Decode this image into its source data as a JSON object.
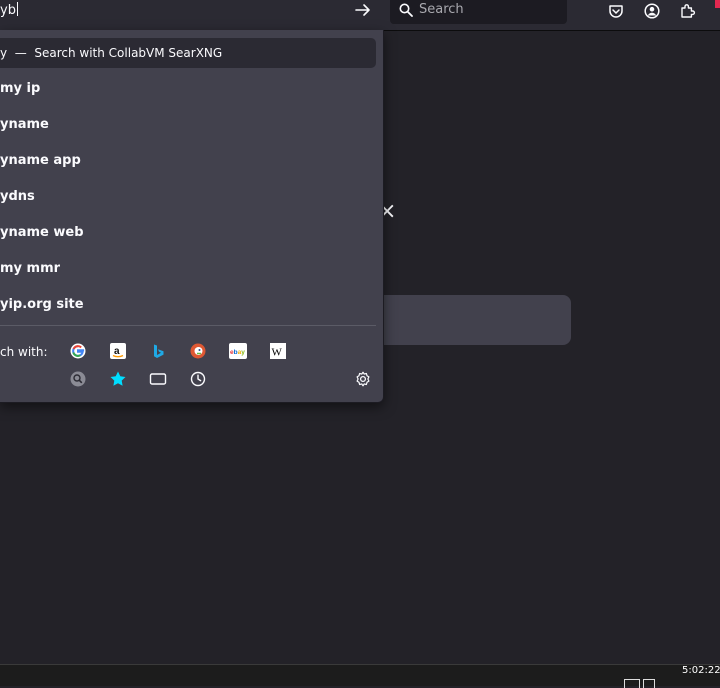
{
  "urlbar": {
    "typed_text": "yb",
    "heuristic_text": "y  —  Search with CollabVM SearXNG"
  },
  "searchbar": {
    "placeholder": "Search"
  },
  "suggestions": [
    "my ip",
    "yname",
    "yname app",
    "ydns",
    "yname web",
    "my mmr",
    "yip.org site"
  ],
  "one_off": {
    "label": "ch with:",
    "engines": [
      "google-icon",
      "amazon-icon",
      "bing-icon",
      "duckduckgo-icon",
      "ebay-icon",
      "wikipedia-icon"
    ],
    "modes": [
      "searxng-icon",
      "bookmarks-star-icon",
      "tabs-icon",
      "history-icon",
      "settings-gear-icon"
    ]
  },
  "taskbar": {
    "clock": "5:02:22"
  },
  "colors": {
    "toolbar_bg": "#2b2a33",
    "dropdown_bg": "#42414d",
    "page_bg": "#232228",
    "bookmark_star": "#00ddff",
    "accent_red": "#e22850"
  }
}
